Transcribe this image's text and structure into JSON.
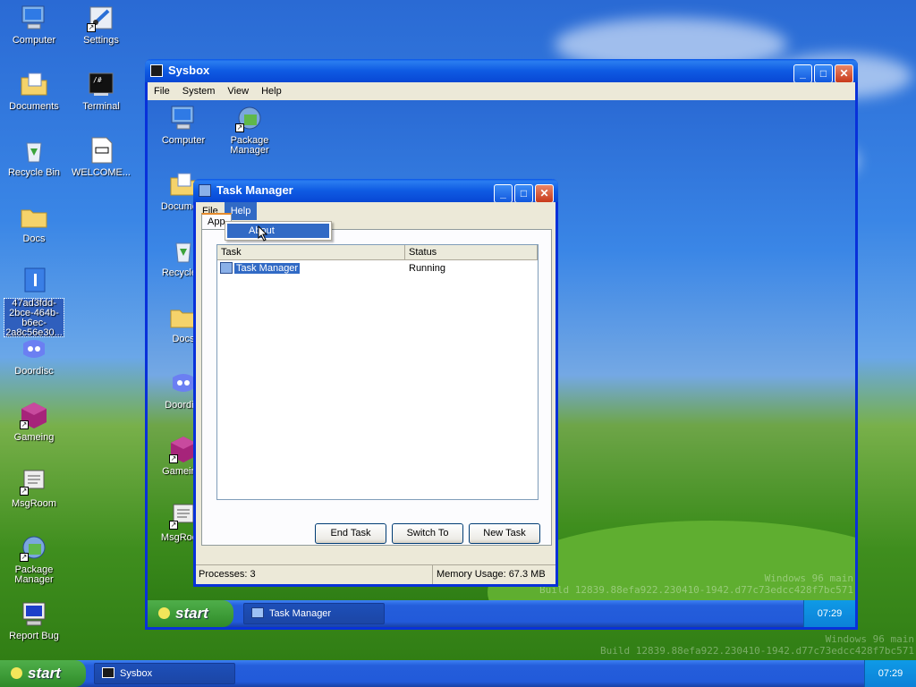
{
  "desktop": {
    "icons": [
      {
        "label": "Computer"
      },
      {
        "label": "Settings"
      },
      {
        "label": "Documents"
      },
      {
        "label": "Terminal"
      },
      {
        "label": "Recycle Bin"
      },
      {
        "label": "WELCOME..."
      },
      {
        "label": "Docs"
      },
      {
        "label": "47ad3fdd-2bce-464b-b6ec-2a8c56e30..."
      },
      {
        "label": "Doordisc"
      },
      {
        "label": "Gameing"
      },
      {
        "label": "MsgRoom"
      },
      {
        "label": "Package Manager"
      },
      {
        "label": "Report Bug"
      }
    ],
    "watermark_line1": "Windows 96 main",
    "watermark_line2": "Build 12839.88efa922.230410-1942.d77c73edcc428f7bc571"
  },
  "taskbar": {
    "start_label": "start",
    "window_button": "Sysbox",
    "clock": "07:29"
  },
  "sysbox": {
    "title": "Sysbox",
    "menu": [
      "File",
      "System",
      "View",
      "Help"
    ],
    "icons": [
      {
        "label": "Computer"
      },
      {
        "label": "Package Manager"
      },
      {
        "label": "Docume..."
      },
      {
        "label": "Recycle..."
      },
      {
        "label": "Docs"
      },
      {
        "label": "Doordi..."
      },
      {
        "label": "Gamein..."
      },
      {
        "label": "MsgRoo..."
      }
    ],
    "watermark_line1": "Windows 96 main",
    "watermark_line2": "Build 12839.88efa922.230410-1942.d77c73edcc428f7bc571",
    "taskbar": {
      "start_label": "start",
      "window_button": "Task Manager",
      "clock": "07:29"
    }
  },
  "taskmanager": {
    "title": "Task Manager",
    "menu": [
      "File",
      "Help"
    ],
    "help_menu_item": "About",
    "tab_label": "App",
    "columns": [
      "Task",
      "Status"
    ],
    "rows": [
      {
        "task": "Task Manager",
        "status": "Running"
      }
    ],
    "buttons": {
      "end_task": "End Task",
      "switch_to": "Switch To",
      "new_task": "New Task"
    },
    "status": {
      "processes": "Processes: 3",
      "memory": "Memory Usage: 67.3 MB"
    }
  }
}
